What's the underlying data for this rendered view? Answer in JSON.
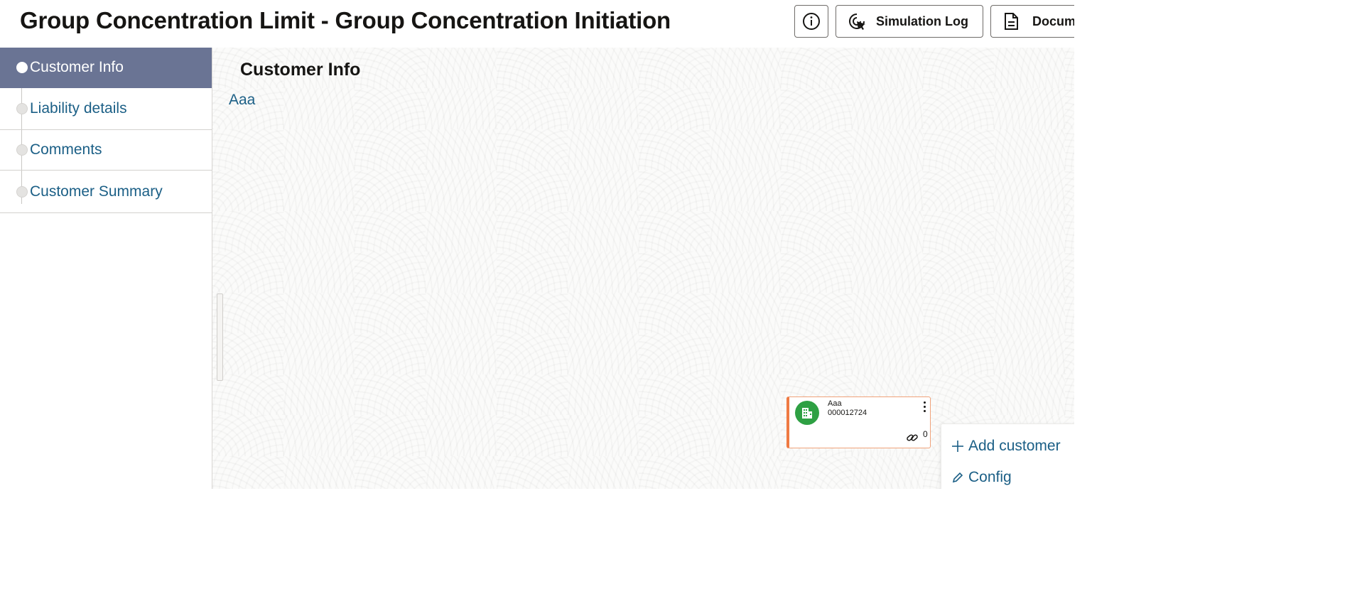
{
  "header": {
    "title": "Group Concentration Limit - Group Concentration Initiation",
    "buttons": {
      "info_icon": "info-icon",
      "simulation_log": "Simulation Log",
      "documents": "Docum"
    }
  },
  "sidebar": {
    "steps": [
      {
        "label": "Customer Info",
        "active": true
      },
      {
        "label": "Liability details",
        "active": false
      },
      {
        "label": "Comments",
        "active": false
      },
      {
        "label": "Customer Summary",
        "active": false
      }
    ]
  },
  "main": {
    "section_title": "Customer Info",
    "tree_root": "Aaa",
    "card": {
      "name": "Aaa",
      "id": "000012724",
      "link_count": "0",
      "avatar_color": "#2ea043",
      "accent_color": "#ef7a43"
    },
    "menu": {
      "items": [
        {
          "label": "Add customer",
          "icon": "plus-icon"
        },
        {
          "label": "Config",
          "icon": "pencil-icon"
        }
      ]
    }
  },
  "colors": {
    "active_step_bg": "#6a7494",
    "link_text": "#1b5f86"
  }
}
